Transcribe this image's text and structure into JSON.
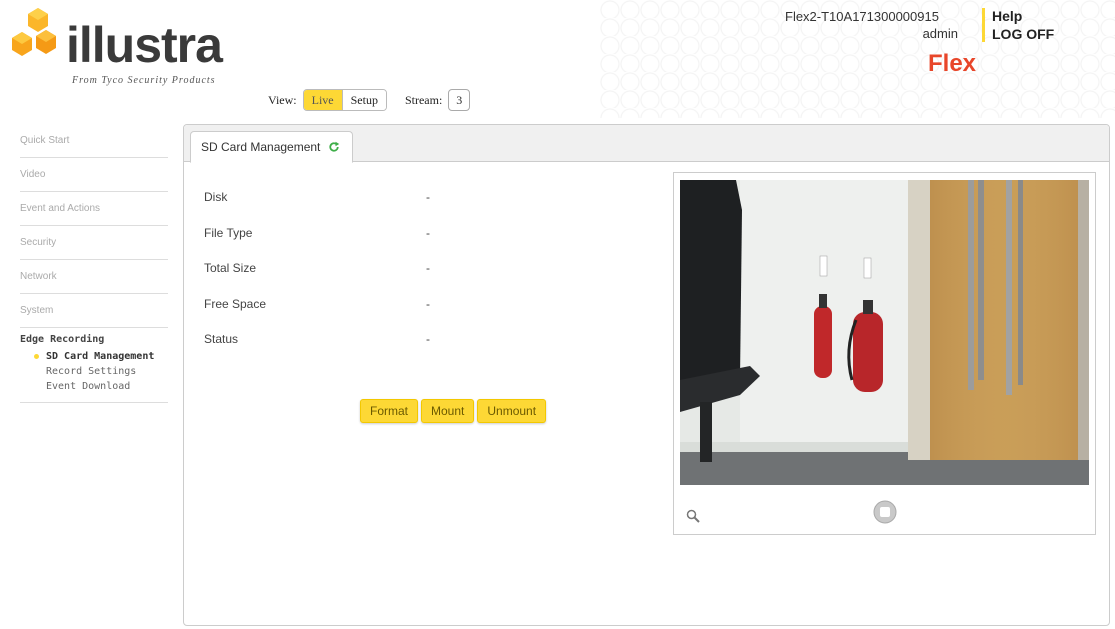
{
  "brand": {
    "name": "illustra",
    "tagline": "From Tyco Security Products",
    "product": "Flex"
  },
  "header": {
    "view_label": "View:",
    "view_live": "Live",
    "view_setup": "Setup",
    "stream_label": "Stream:",
    "stream_value": "3",
    "device_name": "Flex2-T10A171300000915",
    "username": "admin",
    "help": "Help",
    "logoff": "LOG OFF"
  },
  "sidebar": {
    "items": [
      {
        "label": "Quick Start"
      },
      {
        "label": "Video"
      },
      {
        "label": "Event and Actions"
      },
      {
        "label": "Security"
      },
      {
        "label": "Network"
      },
      {
        "label": "System"
      }
    ],
    "group": {
      "label": "Edge Recording",
      "subitems": [
        {
          "label": "SD Card Management",
          "active": true
        },
        {
          "label": "Record Settings",
          "active": false
        },
        {
          "label": "Event Download",
          "active": false
        }
      ]
    }
  },
  "main": {
    "tab_label": "SD Card Management",
    "fields": [
      {
        "key": "Disk",
        "value": "-"
      },
      {
        "key": "File Type",
        "value": "-"
      },
      {
        "key": "Total Size",
        "value": "-"
      },
      {
        "key": "Free Space",
        "value": "-"
      },
      {
        "key": "Status",
        "value": "-"
      }
    ],
    "buttons": {
      "format": "Format",
      "mount": "Mount",
      "unmount": "Unmount"
    }
  },
  "colors": {
    "accent": "#fdd835",
    "brand_red": "#e8462a"
  },
  "icons": {
    "refresh": "refresh-icon",
    "zoom": "zoom-icon",
    "stop": "stop-icon"
  }
}
